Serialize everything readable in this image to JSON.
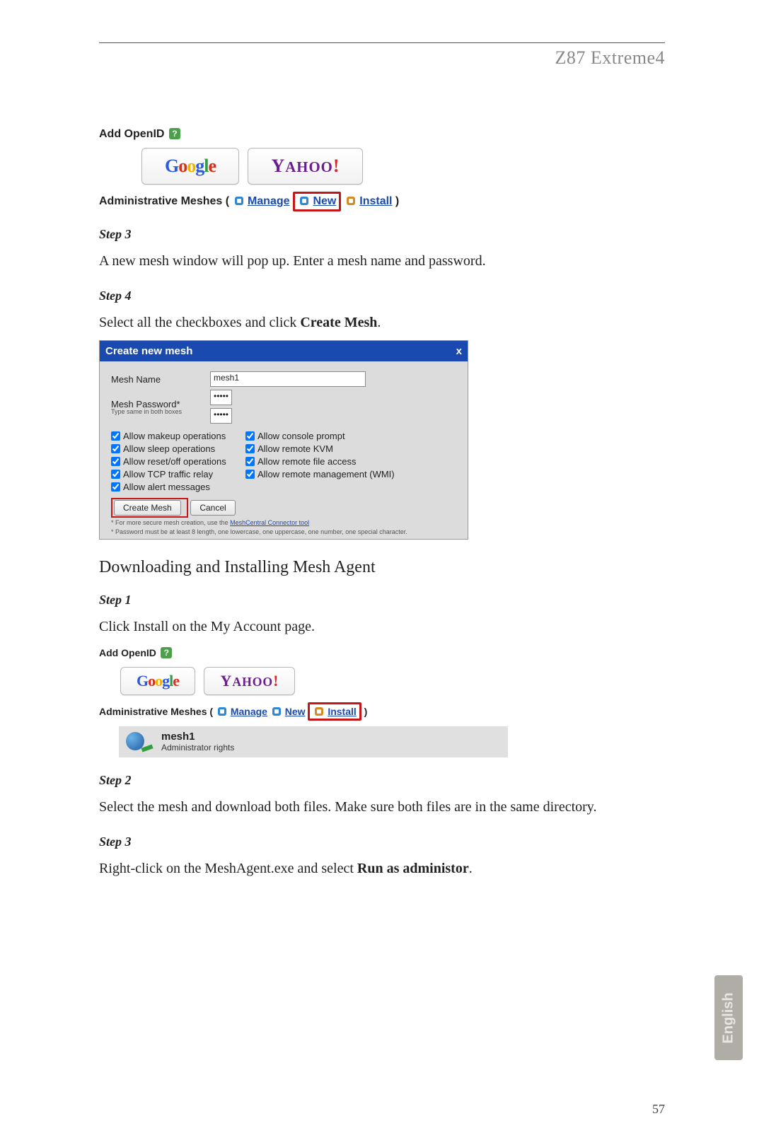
{
  "header": {
    "product": "Z87 Extreme4"
  },
  "page_number": "57",
  "lang_tab": "English",
  "openid": {
    "title": "Add OpenID",
    "google": "Google",
    "yahoo": "YAHOO!",
    "admin_label": "Administrative Meshes",
    "manage": "Manage",
    "new": "New",
    "install": "Install"
  },
  "step3": {
    "label": "Step 3",
    "text": "A new mesh window will pop up. Enter a mesh name and password."
  },
  "step4": {
    "label": "Step 4",
    "text_pre": "Select all the checkboxes and click ",
    "text_bold": "Create Mesh",
    "text_post": "."
  },
  "dlg": {
    "title": "Create new mesh",
    "close": "x",
    "name_label": "Mesh Name",
    "name_value": "mesh1",
    "pass_label": "Mesh Password*",
    "pass_note": "Type same in both boxes",
    "pass_value": "•••••",
    "checks": {
      "c1": "Allow makeup operations",
      "c2": "Allow console prompt",
      "c3": "Allow sleep operations",
      "c4": "Allow remote KVM",
      "c5": "Allow reset/off operations",
      "c6": "Allow remote file access",
      "c7": "Allow TCP traffic relay",
      "c8": "Allow remote management (WMI)",
      "c9": "Allow alert messages"
    },
    "create_btn": "Create Mesh",
    "cancel_btn": "Cancel",
    "fine1_pre": "* For more secure mesh creation, use the ",
    "fine1_link": "MeshCentral Connector tool",
    "fine2": "* Password must be at least 8 length, one lowercase, one uppercase, one number, one special character."
  },
  "section2": {
    "heading": "Downloading and Installing Mesh Agent"
  },
  "s2step1": {
    "label": "Step 1",
    "text": "Click Install on the My Account page."
  },
  "mesh_row": {
    "name": "mesh1",
    "role": "Administrator rights"
  },
  "s2step2": {
    "label": "Step 2",
    "text": "Select the mesh and download both files. Make sure both files are in the same directory."
  },
  "s2step3": {
    "label": "Step 3",
    "text_pre": "Right-click on the MeshAgent.exe and select ",
    "text_bold": "Run as administor",
    "text_post": "."
  }
}
